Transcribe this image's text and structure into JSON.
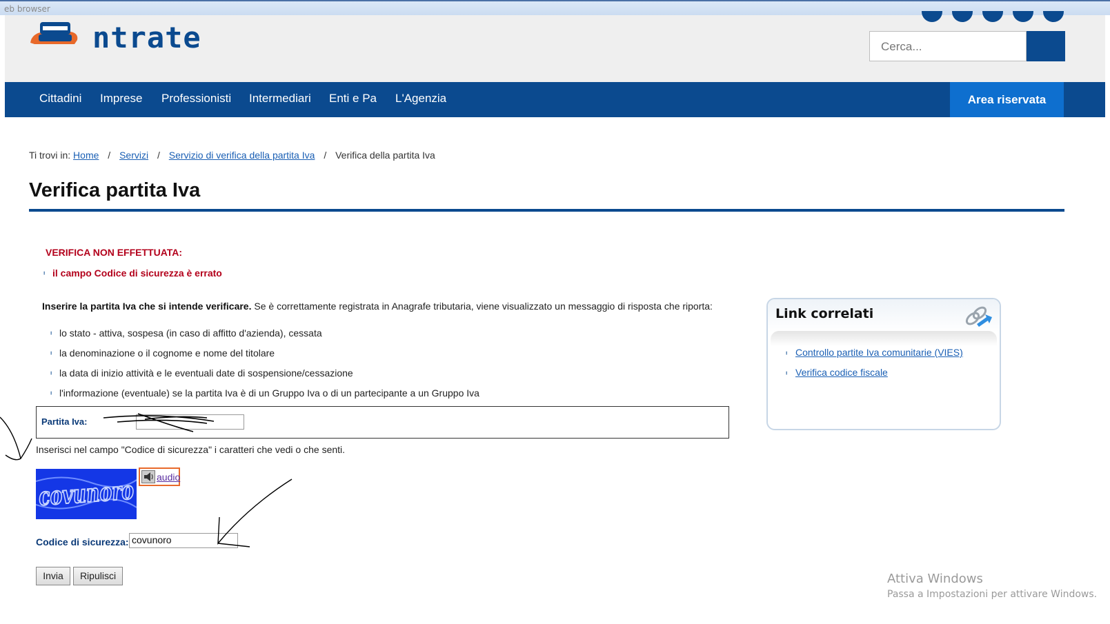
{
  "browser": {
    "title_fragment": "eb browser"
  },
  "header": {
    "logo_text": "ntrate",
    "search_placeholder": "Cerca...",
    "colors": {
      "brand_blue": "#0b4a8f",
      "accent_blue": "#0e6fcf",
      "logo_orange": "#e8692a"
    }
  },
  "nav": {
    "items": [
      "Cittadini",
      "Imprese",
      "Professionisti",
      "Intermediari",
      "Enti e Pa",
      "L'Agenzia"
    ],
    "area_riservata": "Area riservata"
  },
  "breadcrumb": {
    "prefix": "Ti trovi in:",
    "links": [
      "Home",
      "Servizi",
      "Servizio di verifica della partita Iva"
    ],
    "current": "Verifica della partita Iva"
  },
  "page": {
    "title": "Verifica partita Iva",
    "error_title": "VERIFICA NON EFFETTUATA:",
    "error_item": "il campo Codice di sicurezza è errato",
    "intro_bold": "Inserire la partita Iva che si intende verificare.",
    "intro_rest": " Se è correttamente registrata in Anagrafe tributaria, viene visualizzato un messaggio di risposta che riporta:",
    "list": [
      "lo stato - attiva, sospesa (in caso di affitto d'azienda), cessata",
      "la denominazione o il cognome e nome del titolare",
      "la data di inizio attività e le eventuali date di sospensione/cessazione",
      "l'informazione (eventuale) se la partita Iva è di un Gruppo Iva o di un partecipante a un Gruppo Iva"
    ]
  },
  "form": {
    "piva_label": "Partita Iva:",
    "captcha_hint": "Inserisci nel campo \"Codice di sicurezza\" i caratteri che vedi o che senti.",
    "captcha_text": "covunoro",
    "audio_label": "audio",
    "code_label": "Codice di sicurezza:",
    "code_value": "covunoro",
    "submit_label": "Invia",
    "reset_label": "Ripulisci"
  },
  "sidebar": {
    "title": "Link correlati",
    "links": [
      "Controllo partite Iva comunitarie (VIES)",
      "Verifica codice fiscale"
    ]
  },
  "watermark": {
    "line1": "Attiva Windows",
    "line2": "Passa a Impostazioni per attivare Windows."
  }
}
